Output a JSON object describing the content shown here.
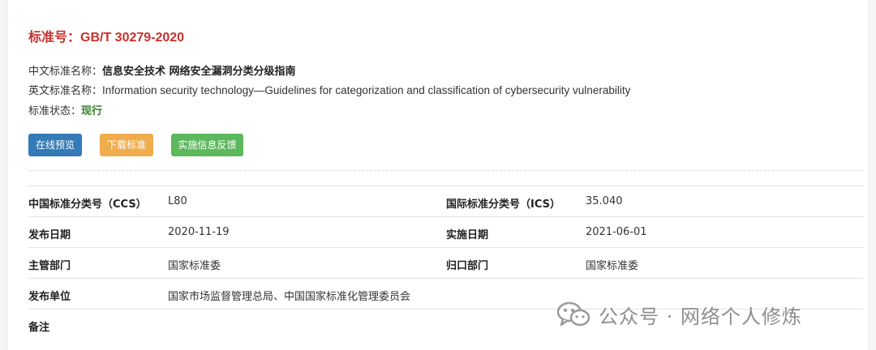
{
  "header": {
    "title": "标准号：GB/T 30279-2020"
  },
  "meta": {
    "cn_name_label": "中文标准名称：",
    "cn_name_value": "信息安全技术 网络安全漏洞分类分级指南",
    "en_name_label": "英文标准名称：",
    "en_name_value": "Information security technology—Guidelines for categorization and classification of cybersecurity vulnerability",
    "status_label": "标准状态：",
    "status_value": "现行"
  },
  "actions": {
    "preview_label": "在线预览",
    "download_label": "下载标准",
    "feedback_label": "实施信息反馈"
  },
  "details": {
    "rows": [
      {
        "l1": "中国标准分类号（CCS）",
        "v1": "L80",
        "l2": "国际标准分类号（ICS）",
        "v2": "35.040"
      },
      {
        "l1": "发布日期",
        "v1": "2020-11-19",
        "l2": "实施日期",
        "v2": "2021-06-01"
      },
      {
        "l1": "主管部门",
        "v1": "国家标准委",
        "l2": "归口部门",
        "v2": "国家标准委"
      },
      {
        "l1": "发布单位",
        "v1": "国家市场监督管理总局、中国国家标准化管理委员会",
        "l2": "",
        "v2": ""
      },
      {
        "l1": "备注",
        "v1": "",
        "l2": "",
        "v2": ""
      }
    ]
  },
  "watermark": {
    "text": "公众号 · 网络个人修炼",
    "icon": "wechat-icon"
  },
  "colors": {
    "title": "#c9302c",
    "status": "#3a7d2b",
    "btn_blue": "#337ab7",
    "btn_orange": "#f0ad4e",
    "btn_green": "#5cb85c"
  }
}
